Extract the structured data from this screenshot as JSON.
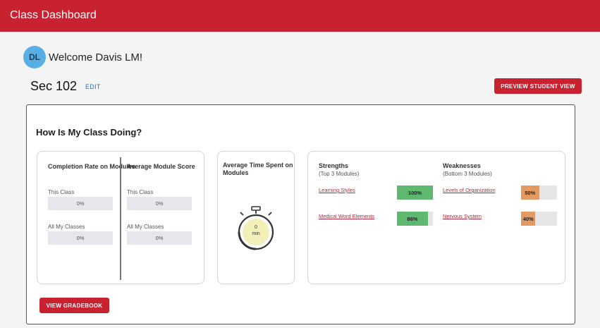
{
  "header": {
    "title": "Class Dashboard"
  },
  "user": {
    "initials": "DL",
    "welcome": "Welcome Davis LM!"
  },
  "section": {
    "name": "Sec 102",
    "edit_label": "EDIT"
  },
  "actions": {
    "preview_label": "PREVIEW STUDENT VIEW",
    "gradebook_label": "VIEW GRADEBOOK"
  },
  "panel": {
    "title": "How Is My Class Doing?"
  },
  "completion": {
    "heading": "Completion Rate on Modules",
    "this_class_label": "This Class",
    "this_class_value": "0%",
    "all_label": "All My Classes",
    "all_value": "0%"
  },
  "score": {
    "heading": "Average Module Score",
    "this_class_label": "This Class",
    "this_class_value": "0%",
    "all_label": "All My Classes",
    "all_value": "0%"
  },
  "time": {
    "heading": "Average Time Spent on Modules",
    "value": "0",
    "unit": "min"
  },
  "strengths": {
    "heading": "Strengths",
    "sub": "(Top 3 Modules)",
    "items": [
      {
        "name": "Learning Styles",
        "value": "100%",
        "fraction": 1.0
      },
      {
        "name": "Medical Word Elements",
        "value": "86%",
        "fraction": 0.86
      }
    ]
  },
  "weaknesses": {
    "heading": "Weaknesses",
    "sub": "(Bottom 3 Modules)",
    "items": [
      {
        "name": "Levels of Organization",
        "value": "50%",
        "fraction": 0.5
      },
      {
        "name": "Nervous System",
        "value": "40%",
        "fraction": 0.4
      }
    ]
  },
  "colors": {
    "brand": "#c8212f",
    "strength_fill": "#5fb870",
    "weakness_fill": "#e39a63",
    "avatar_bg": "#5aaee6",
    "link": "#2a6fb0"
  },
  "icons": {
    "timer": "stopwatch-icon"
  }
}
